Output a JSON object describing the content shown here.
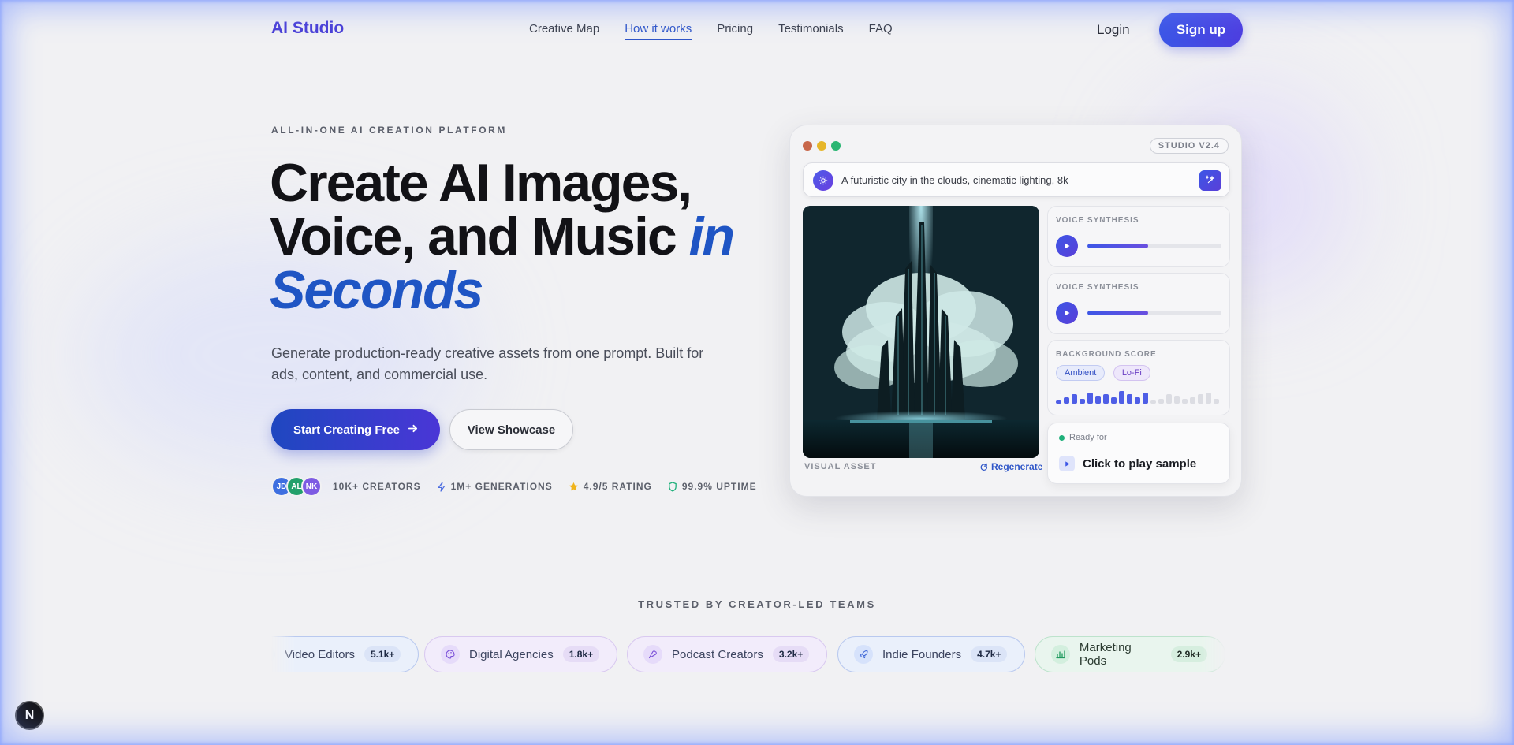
{
  "nav": {
    "logo": "AI Studio",
    "links": [
      "Creative Map",
      "How it works",
      "Pricing",
      "Testimonials",
      "FAQ"
    ],
    "active_link": "How it works",
    "login": "Login",
    "signup": "Sign up"
  },
  "hero": {
    "eyebrow": "ALL-IN-ONE AI CREATION PLATFORM",
    "headline_line1": "Create AI Images,",
    "headline_line2": "Voice, and Music",
    "headline_accent_1": "in",
    "headline_accent_2": "Seconds",
    "subtext": "Generate production-ready creative assets from one prompt. Built for ads, content, and commercial use.",
    "primary_cta": "Start Creating Free",
    "secondary_cta": "View Showcase",
    "avatars": [
      "JD",
      "AL",
      "NK"
    ],
    "stats": [
      {
        "icon": "bolt-icon",
        "text": "10K+ CREATORS"
      },
      {
        "icon": "lightning-icon",
        "text": "1M+ GENERATIONS"
      },
      {
        "icon": "star-icon",
        "text": "4.9/5 RATING"
      },
      {
        "icon": "shield-icon",
        "text": "99.9% UPTIME"
      }
    ]
  },
  "studio": {
    "version": "STUDIO V2.4",
    "prompt": "A futuristic city in the clouds, cinematic lighting, 8k",
    "visual_label": "VISUAL ASSET",
    "regenerate": "Regenerate",
    "voice1": {
      "title": "VOICE SYNTHESIS",
      "progress": 0.45
    },
    "voice2": {
      "title": "VOICE SYNTHESIS",
      "progress": 0.45
    },
    "score": {
      "title": "BACKGROUND SCORE",
      "chips": [
        "Ambient",
        "Lo-Fi"
      ]
    },
    "ready_label": "Ready for",
    "ready_action": "Click to play sample"
  },
  "trusted": {
    "title": "TRUSTED BY CREATOR-LED TEAMS",
    "pills": [
      {
        "label": "Video Editors",
        "count": "5.1k+",
        "icon": "video-icon"
      },
      {
        "label": "Digital Agencies",
        "count": "1.8k+",
        "icon": "palette-icon"
      },
      {
        "label": "Podcast Creators",
        "count": "3.2k+",
        "icon": "mic-icon"
      },
      {
        "label": "Indie Founders",
        "count": "4.7k+",
        "icon": "rocket-icon"
      },
      {
        "label": "Marketing Pods",
        "count": "2.9k+",
        "icon": "chart-icon"
      }
    ]
  },
  "badge": "N",
  "colors": {
    "brand": "#4a3fd6",
    "accent": "#1f55c4",
    "success": "#1fb07a"
  }
}
